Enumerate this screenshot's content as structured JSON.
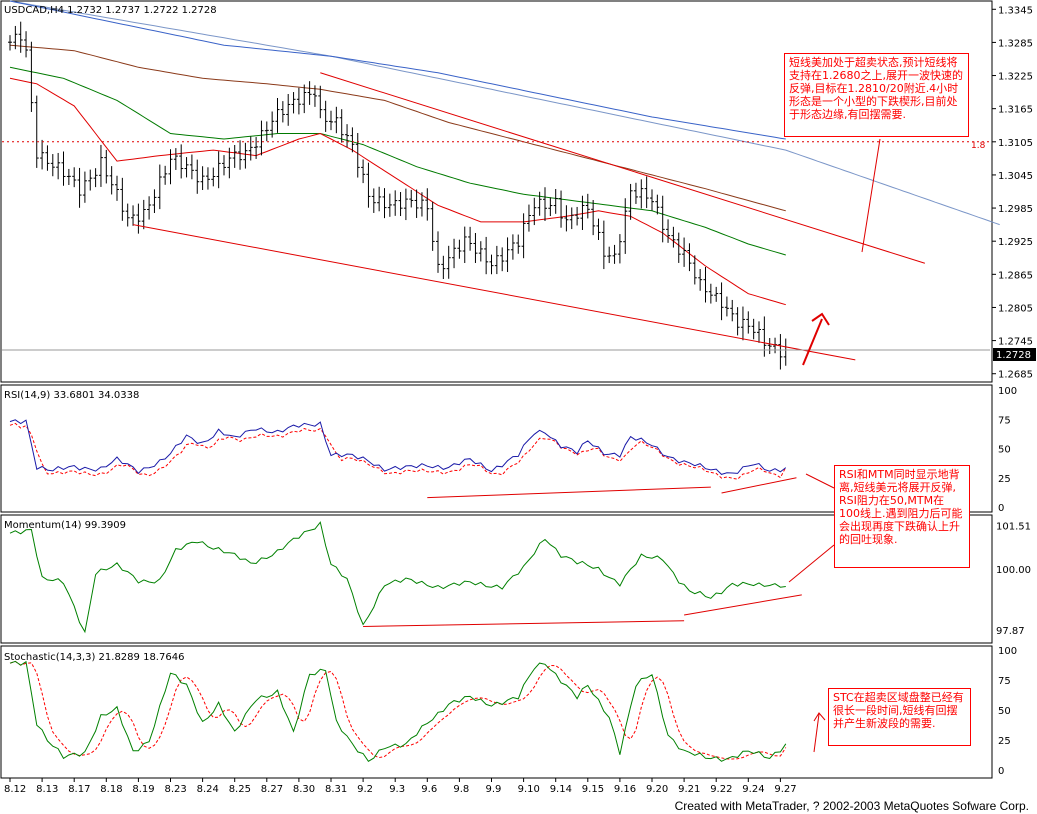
{
  "header": {
    "main_title": "USDCAD,H4 1.2732 1.2737 1.2722 1.2728",
    "rsi_title": "RSI(14,9) 33.6801 34.0338",
    "mom_title": "Momentum(14) 99.3909",
    "sto_title": "Stochastic(14,3,3) 21.8289 18.7646"
  },
  "price_marker": "1.2728",
  "fib_label": "1.8",
  "notes": {
    "main": "短线美加处于超卖状态,预计短线将支持在1.2680之上,展开一波快速的反弹,目标在1.2810/20附近.4小时形态是一个小型的下跌楔形,目前处于形态边缘,有回摆需要.",
    "rsi_mtm": "RSI和MTM同时显示地背离,短线美元将展开反弹, RSI阻力在50,MTM在100线上.遇到阻力后可能会出现再度下跌确认上升的回吐现象.",
    "stc": "STC在超卖区域盘整已经有很长一段时间,短线有回摆并产生新波段的需要."
  },
  "footer": "Created with MetaTrader, ? 2002-2003 MetaQuotes Sofware Corp.",
  "colors": {
    "bar": "#000000",
    "ma_fast": "#e00000",
    "ma_mid": "#007a00",
    "ma_slow": "#8b3a1a",
    "ma_blue": "#3a63c8",
    "ma_lightblue": "#7b96c8",
    "trend": "#e00000",
    "rsi": "#1a1aa8",
    "rsi_signal": "#ff0000",
    "momentum": "#008000",
    "sto_main": "#008000",
    "sto_signal": "#ff0000"
  },
  "chart_data": {
    "type": "line",
    "symbol": "USDCAD",
    "timeframe": "H4",
    "bars_count": 156,
    "x_tick_labels": [
      "8.12",
      "8.13",
      "8.17",
      "8.18",
      "8.19",
      "8.23",
      "8.24",
      "8.25",
      "8.27",
      "8.30",
      "8.31",
      "9.2",
      "9.3",
      "9.6",
      "9.8",
      "9.9",
      "9.10",
      "9.14",
      "9.15",
      "9.16",
      "9.20",
      "9.21",
      "9.22",
      "9.24",
      "9.27"
    ],
    "x_tick_bars": [
      0,
      6,
      12,
      18,
      24,
      30,
      36,
      42,
      48,
      54,
      60,
      66,
      72,
      78,
      84,
      90,
      96,
      102,
      108,
      114,
      120,
      126,
      132,
      138,
      144
    ],
    "price_panel": {
      "y_ticks": [
        "1.3345",
        "1.3285",
        "1.3225",
        "1.3165",
        "1.3105",
        "1.3045",
        "1.2985",
        "1.2925",
        "1.2865",
        "1.2805",
        "1.2745",
        "1.2685"
      ],
      "ylim": [
        1.267,
        1.336
      ],
      "last": 1.2728,
      "close_anchors": [
        [
          0,
          1.328
        ],
        [
          2,
          1.33
        ],
        [
          3,
          1.327
        ],
        [
          5,
          1.309
        ],
        [
          8,
          1.306
        ],
        [
          13,
          1.302
        ],
        [
          17,
          1.307
        ],
        [
          22,
          1.296
        ],
        [
          25,
          1.298
        ],
        [
          30,
          1.307
        ],
        [
          36,
          1.304
        ],
        [
          41,
          1.307
        ],
        [
          44,
          1.308
        ],
        [
          49,
          1.315
        ],
        [
          53,
          1.317
        ],
        [
          57,
          1.32
        ],
        [
          58,
          1.316
        ],
        [
          61,
          1.314
        ],
        [
          64,
          1.309
        ],
        [
          67,
          1.301
        ],
        [
          72,
          1.299
        ],
        [
          78,
          1.299
        ],
        [
          80,
          1.288
        ],
        [
          85,
          1.292
        ],
        [
          90,
          1.289
        ],
        [
          95,
          1.292
        ],
        [
          98,
          1.299
        ],
        [
          102,
          1.3
        ],
        [
          104,
          1.296
        ],
        [
          108,
          1.298
        ],
        [
          111,
          1.291
        ],
        [
          113,
          1.29
        ],
        [
          116,
          1.301
        ],
        [
          120,
          1.3
        ],
        [
          123,
          1.294
        ],
        [
          126,
          1.29
        ],
        [
          129,
          1.284
        ],
        [
          133,
          1.282
        ],
        [
          136,
          1.278
        ],
        [
          139,
          1.276
        ],
        [
          141,
          1.274
        ],
        [
          145,
          1.2728
        ]
      ],
      "ma_fast_anchors": [
        [
          0,
          1.322
        ],
        [
          5,
          1.321
        ],
        [
          12,
          1.317
        ],
        [
          20,
          1.307
        ],
        [
          28,
          1.308
        ],
        [
          38,
          1.309
        ],
        [
          46,
          1.308
        ],
        [
          54,
          1.311
        ],
        [
          58,
          1.312
        ],
        [
          64,
          1.309
        ],
        [
          72,
          1.304
        ],
        [
          80,
          1.299
        ],
        [
          88,
          1.296
        ],
        [
          96,
          1.296
        ],
        [
          104,
          1.297
        ],
        [
          110,
          1.298
        ],
        [
          116,
          1.297
        ],
        [
          122,
          1.294
        ],
        [
          130,
          1.288
        ],
        [
          138,
          1.283
        ],
        [
          145,
          1.281
        ]
      ],
      "ma_mid_anchors": [
        [
          0,
          1.324
        ],
        [
          10,
          1.322
        ],
        [
          20,
          1.318
        ],
        [
          30,
          1.312
        ],
        [
          40,
          1.311
        ],
        [
          50,
          1.312
        ],
        [
          58,
          1.312
        ],
        [
          66,
          1.31
        ],
        [
          76,
          1.306
        ],
        [
          86,
          1.303
        ],
        [
          96,
          1.301
        ],
        [
          104,
          1.3
        ],
        [
          112,
          1.299
        ],
        [
          120,
          1.298
        ],
        [
          130,
          1.295
        ],
        [
          138,
          1.292
        ],
        [
          145,
          1.29
        ]
      ],
      "ma_slow_anchors": [
        [
          0,
          1.328
        ],
        [
          12,
          1.327
        ],
        [
          24,
          1.324
        ],
        [
          36,
          1.322
        ],
        [
          48,
          1.321
        ],
        [
          58,
          1.32
        ],
        [
          70,
          1.318
        ],
        [
          82,
          1.314
        ],
        [
          94,
          1.311
        ],
        [
          106,
          1.308
        ],
        [
          118,
          1.305
        ],
        [
          130,
          1.302
        ],
        [
          145,
          1.298
        ]
      ],
      "ma_blue_anchors": [
        [
          0,
          1.336
        ],
        [
          20,
          1.332
        ],
        [
          40,
          1.328
        ],
        [
          60,
          1.326
        ],
        [
          80,
          1.323
        ],
        [
          100,
          1.319
        ],
        [
          120,
          1.315
        ],
        [
          145,
          1.311
        ]
      ],
      "ma_lightblue_anchors": [
        [
          0,
          1.336
        ],
        [
          30,
          1.331
        ],
        [
          60,
          1.326
        ],
        [
          90,
          1.32
        ],
        [
          120,
          1.314
        ],
        [
          145,
          1.309
        ],
        [
          185,
          1.2955
        ]
      ],
      "trendlines": [
        [
          [
            23,
            1.2955
          ],
          [
            158,
            1.271
          ]
        ],
        [
          [
            58,
            1.323
          ],
          [
            171,
            1.2885
          ]
        ]
      ]
    },
    "rsi": {
      "y_ticks": [
        "100",
        "75",
        "50",
        "25",
        "0"
      ],
      "ylim": [
        0,
        100
      ],
      "last": 33.6801,
      "signal_last": 34.0338,
      "anchors": [
        [
          0,
          72
        ],
        [
          3,
          74
        ],
        [
          5,
          35
        ],
        [
          8,
          31
        ],
        [
          12,
          34
        ],
        [
          17,
          33
        ],
        [
          20,
          40
        ],
        [
          24,
          31
        ],
        [
          28,
          39
        ],
        [
          30,
          45
        ],
        [
          33,
          60
        ],
        [
          36,
          55
        ],
        [
          39,
          65
        ],
        [
          42,
          58
        ],
        [
          46,
          68
        ],
        [
          50,
          64
        ],
        [
          54,
          69
        ],
        [
          58,
          72
        ],
        [
          60,
          45
        ],
        [
          64,
          43
        ],
        [
          67,
          40
        ],
        [
          70,
          33
        ],
        [
          74,
          33
        ],
        [
          78,
          36
        ],
        [
          82,
          34
        ],
        [
          86,
          40
        ],
        [
          90,
          32
        ],
        [
          95,
          44
        ],
        [
          98,
          63
        ],
        [
          100,
          65
        ],
        [
          103,
          53
        ],
        [
          106,
          46
        ],
        [
          108,
          56
        ],
        [
          111,
          47
        ],
        [
          114,
          45
        ],
        [
          116,
          59
        ],
        [
          120,
          53
        ],
        [
          123,
          44
        ],
        [
          126,
          38
        ],
        [
          130,
          33
        ],
        [
          135,
          29
        ],
        [
          139,
          36
        ],
        [
          142,
          31
        ],
        [
          145,
          34
        ]
      ],
      "trendlines": [
        [
          [
            78,
            8
          ],
          [
            131,
            17
          ]
        ],
        [
          [
            133,
            12
          ],
          [
            147,
            25
          ]
        ]
      ]
    },
    "momentum": {
      "y_ticks": [
        "101.51",
        "100.00",
        "97.87"
      ],
      "ylim": [
        97.6,
        101.7
      ],
      "last": 99.3909,
      "anchors": [
        [
          0,
          101.2
        ],
        [
          4,
          101.4
        ],
        [
          6,
          99.7
        ],
        [
          10,
          99.5
        ],
        [
          14,
          97.8
        ],
        [
          16,
          99.9
        ],
        [
          20,
          100.1
        ],
        [
          24,
          99.6
        ],
        [
          28,
          99.6
        ],
        [
          31,
          100.6
        ],
        [
          35,
          101.0
        ],
        [
          40,
          100.6
        ],
        [
          45,
          100.2
        ],
        [
          50,
          100.6
        ],
        [
          54,
          101.1
        ],
        [
          58,
          101.6
        ],
        [
          60,
          100.2
        ],
        [
          63,
          99.6
        ],
        [
          66,
          98.0
        ],
        [
          70,
          99.5
        ],
        [
          74,
          99.6
        ],
        [
          80,
          99.4
        ],
        [
          86,
          99.5
        ],
        [
          92,
          99.4
        ],
        [
          96,
          100.0
        ],
        [
          100,
          101.1
        ],
        [
          103,
          100.5
        ],
        [
          106,
          100.2
        ],
        [
          110,
          100.0
        ],
        [
          114,
          99.5
        ],
        [
          118,
          100.4
        ],
        [
          122,
          100.4
        ],
        [
          125,
          99.6
        ],
        [
          127,
          99.2
        ],
        [
          131,
          99.0
        ],
        [
          135,
          99.5
        ],
        [
          140,
          99.4
        ],
        [
          145,
          99.5
        ]
      ],
      "trendlines": [
        [
          [
            66,
            98.0
          ],
          [
            126,
            98.2
          ]
        ],
        [
          [
            126,
            98.4
          ],
          [
            148,
            99.1
          ]
        ]
      ]
    },
    "stochastic": {
      "y_ticks": [
        "100",
        "75",
        "50",
        "25",
        "0"
      ],
      "ylim": [
        0,
        100
      ],
      "last": 21.8289,
      "signal_last": 18.7646,
      "anchors": [
        [
          0,
          88
        ],
        [
          3,
          90
        ],
        [
          5,
          40
        ],
        [
          7,
          25
        ],
        [
          10,
          10
        ],
        [
          14,
          15
        ],
        [
          17,
          45
        ],
        [
          20,
          50
        ],
        [
          23,
          15
        ],
        [
          26,
          25
        ],
        [
          30,
          80
        ],
        [
          33,
          70
        ],
        [
          36,
          40
        ],
        [
          39,
          55
        ],
        [
          42,
          30
        ],
        [
          46,
          60
        ],
        [
          50,
          65
        ],
        [
          53,
          30
        ],
        [
          56,
          80
        ],
        [
          59,
          85
        ],
        [
          61,
          40
        ],
        [
          64,
          20
        ],
        [
          67,
          8
        ],
        [
          70,
          20
        ],
        [
          74,
          20
        ],
        [
          78,
          40
        ],
        [
          82,
          55
        ],
        [
          86,
          60
        ],
        [
          90,
          55
        ],
        [
          95,
          60
        ],
        [
          98,
          85
        ],
        [
          100,
          90
        ],
        [
          103,
          75
        ],
        [
          106,
          60
        ],
        [
          108,
          70
        ],
        [
          112,
          45
        ],
        [
          114,
          15
        ],
        [
          117,
          70
        ],
        [
          120,
          80
        ],
        [
          123,
          30
        ],
        [
          126,
          15
        ],
        [
          130,
          10
        ],
        [
          134,
          10
        ],
        [
          138,
          15
        ],
        [
          142,
          10
        ],
        [
          145,
          22
        ]
      ]
    }
  }
}
